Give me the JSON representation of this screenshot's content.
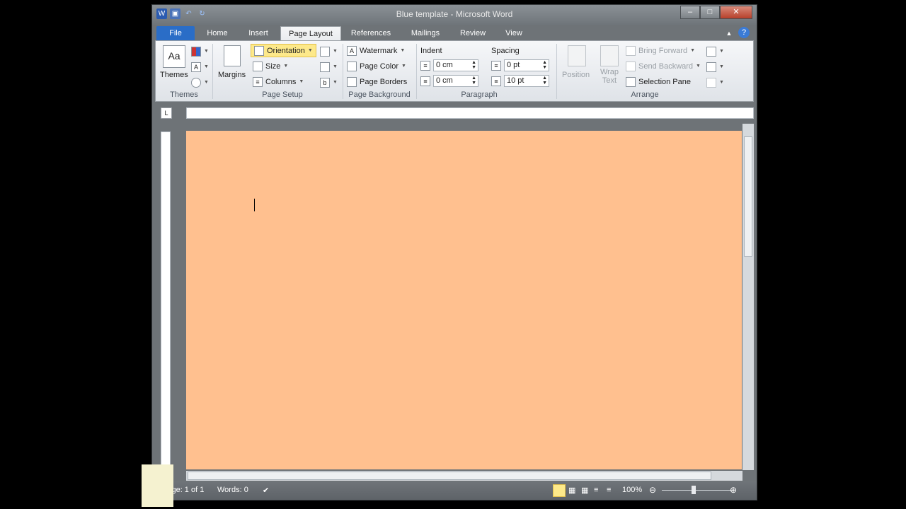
{
  "window": {
    "title": "Blue template - Microsoft Word",
    "min": "–",
    "max": "□",
    "close": "✕"
  },
  "qat": {
    "word": "W",
    "save": "▣",
    "undo": "↶",
    "redo": "↻"
  },
  "tabs": [
    "File",
    "Home",
    "Insert",
    "Page Layout",
    "References",
    "Mailings",
    "Review",
    "View"
  ],
  "ribbon": {
    "themes": {
      "label": "Themes",
      "group": "Themes"
    },
    "page_setup": {
      "margins": "Margins",
      "orientation": "Orientation",
      "size": "Size",
      "columns": "Columns",
      "group": "Page Setup"
    },
    "page_background": {
      "watermark": "Watermark",
      "page_color": "Page Color",
      "page_borders": "Page Borders",
      "group": "Page Background"
    },
    "paragraph": {
      "indent": "Indent",
      "spacing": "Spacing",
      "indent_left": "0 cm",
      "indent_right": "0 cm",
      "spacing_before": "0 pt",
      "spacing_after": "10 pt",
      "group": "Paragraph"
    },
    "arrange": {
      "position": "Position",
      "wrap_text": "Wrap Text",
      "bring_forward": "Bring Forward",
      "send_backward": "Send Backward",
      "selection_pane": "Selection Pane",
      "group": "Arrange"
    }
  },
  "status": {
    "page": "Page: 1 of 1",
    "words": "Words: 0",
    "zoom": "100%"
  },
  "colors": {
    "page": "#ffc08f",
    "file_tab": "#2a6dc7"
  }
}
